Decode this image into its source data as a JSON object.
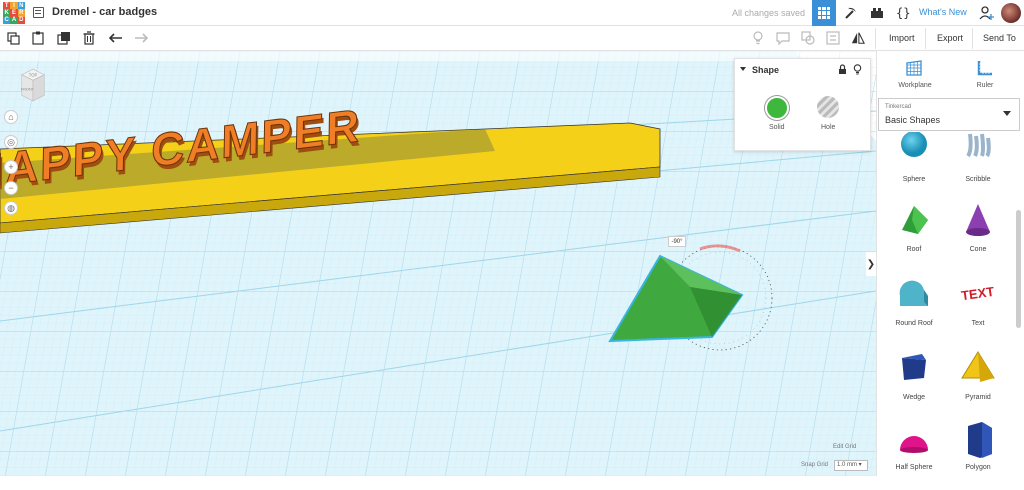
{
  "app": {
    "logo_letters": [
      "TIN",
      "KER",
      "CAD"
    ],
    "document_title": "Dremel - car badges",
    "save_status": "All changes saved",
    "whats_new": "What's New"
  },
  "toolbar": {
    "import_label": "Import",
    "export_label": "Export",
    "send_to_label": "Send To"
  },
  "viewcube": {
    "top_label": "TOP",
    "front_label": "FRONT"
  },
  "shape_panel": {
    "title": "Shape",
    "solid_label": "Solid",
    "hole_label": "Hole",
    "solid_color": "#3db83d"
  },
  "scene": {
    "badge_text": "HAPPY CAMPER",
    "rotation_angle": "-90°",
    "badge_color": "#f5d018",
    "letter_color": "#f07e26",
    "selected_shape_color": "#3fa83f",
    "grid_color": "#9fdcf0"
  },
  "sidebar": {
    "workplane_label": "Workplane",
    "ruler_label": "Ruler",
    "library_small": "Tinkercad",
    "library_value": "Basic Shapes",
    "shapes": [
      {
        "label": "Sphere",
        "icon": "sphere-icon"
      },
      {
        "label": "Scribble",
        "icon": "scribble-icon"
      },
      {
        "label": "Roof",
        "icon": "roof-icon"
      },
      {
        "label": "Cone",
        "icon": "cone-icon"
      },
      {
        "label": "Round Roof",
        "icon": "round-roof-icon"
      },
      {
        "label": "Text",
        "icon": "text-icon"
      },
      {
        "label": "Wedge",
        "icon": "wedge-icon"
      },
      {
        "label": "Pyramid",
        "icon": "pyramid-icon"
      },
      {
        "label": "Half Sphere",
        "icon": "half-sphere-icon"
      },
      {
        "label": "Polygon",
        "icon": "polygon-icon"
      }
    ]
  },
  "footer": {
    "edit_grid": "Edit Grid",
    "snap_grid_label": "Snap Grid",
    "snap_grid_value": "1.0 mm"
  }
}
